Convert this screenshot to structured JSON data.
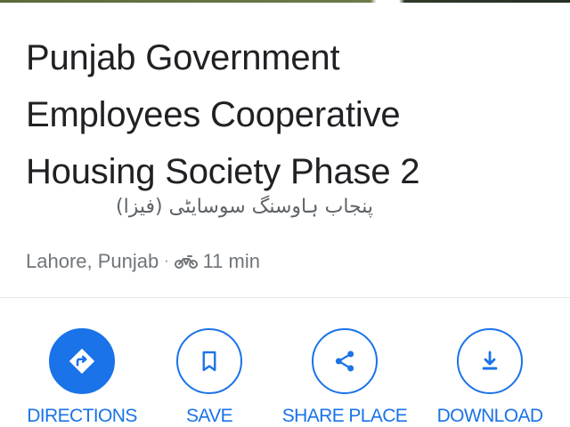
{
  "place": {
    "title_lines": [
      "Punjab Government",
      "Employees Cooperative",
      "Housing Society Phase 2"
    ],
    "native_name": "پنجاب ہاوسنگ سوسایٹی (فیزا)",
    "location": "Lahore, Punjab",
    "separator": "·",
    "travel_time": "11 min",
    "travel_mode_icon": "motorcycle-icon"
  },
  "actions": [
    {
      "label": "DIRECTIONS",
      "icon": "directions-icon"
    },
    {
      "label": "SAVE",
      "icon": "bookmark-icon"
    },
    {
      "label": "SHARE PLACE",
      "icon": "share-icon"
    },
    {
      "label": "DOWNLOAD",
      "icon": "download-icon"
    }
  ],
  "colors": {
    "accent": "#1a73e8",
    "title": "#202124",
    "secondary": "#70757a"
  }
}
